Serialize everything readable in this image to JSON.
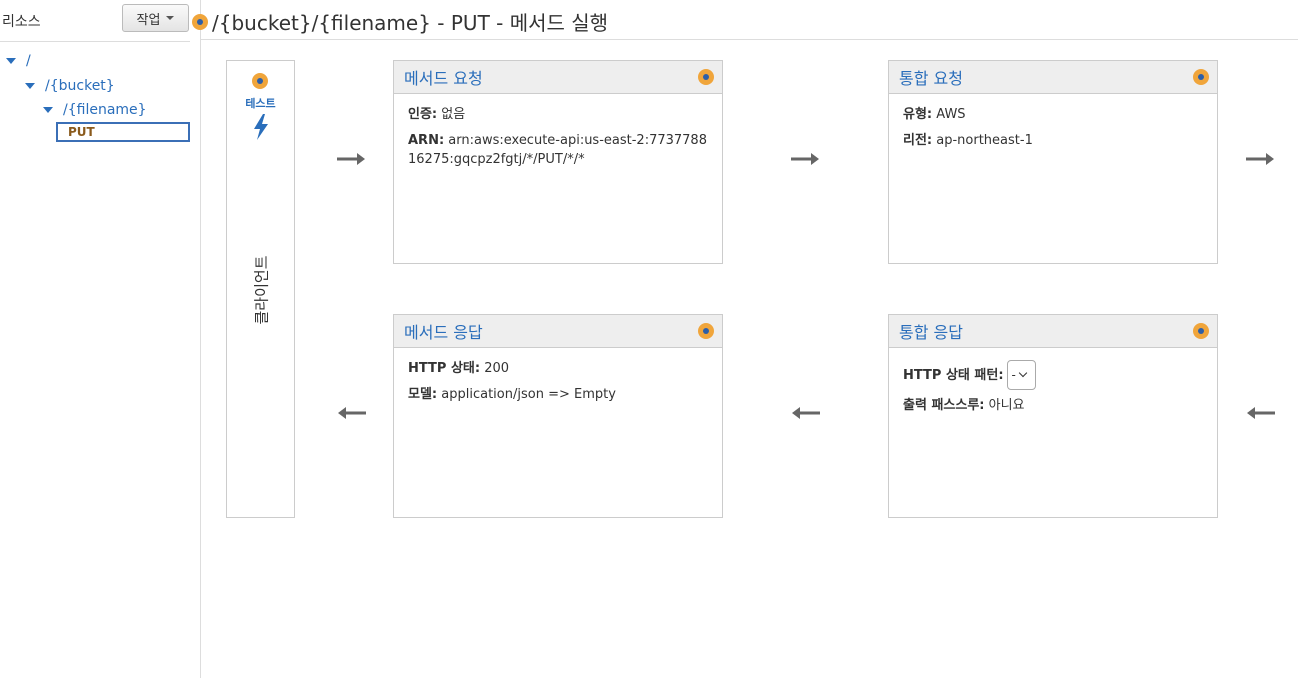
{
  "sidebar": {
    "title": "리소스",
    "action_label": "작업",
    "tree": [
      {
        "label": "/"
      },
      {
        "label": "/{bucket}"
      },
      {
        "label": "/{filename}"
      }
    ],
    "method": "PUT"
  },
  "header": {
    "title": "/{bucket}/{filename} - PUT - 메서드 실행"
  },
  "client": {
    "test_label": "테스트",
    "label": "클라이언트"
  },
  "method_request": {
    "title": "메서드 요청",
    "auth_label": "인증:",
    "auth_value": "없음",
    "arn_label": "ARN:",
    "arn_value": "arn:aws:execute-api:us-east-2:773778816275:gqcpz2fgtj/*/PUT/*/*"
  },
  "integration_request": {
    "title": "통합 요청",
    "type_label": "유형:",
    "type_value": "AWS",
    "region_label": "리전:",
    "region_value": "ap-northeast-1"
  },
  "method_response": {
    "title": "메서드 응답",
    "status_label": "HTTP 상태:",
    "status_value": "200",
    "model_label": "모델:",
    "model_value": "application/json => Empty"
  },
  "integration_response": {
    "title": "통합 응답",
    "pattern_label": "HTTP 상태 패턴:",
    "pattern_value": "-",
    "passthrough_label": "출력 패스스루:",
    "passthrough_value": "아니요"
  },
  "icons": {
    "info_dot": "info-dot-icon",
    "bolt": "lightning-bolt-icon",
    "arrow_right": "arrow-right-icon",
    "arrow_left": "arrow-left-icon"
  },
  "colors": {
    "link_blue": "#2a6ebb",
    "dot_orange": "#f0a53b",
    "dot_center": "#2d5fa8",
    "method_brown": "#8a5a1c"
  }
}
